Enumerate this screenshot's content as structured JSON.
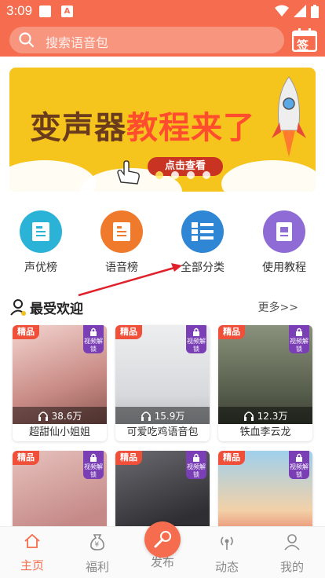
{
  "status_bar": {
    "time": "3:09"
  },
  "search": {
    "placeholder": "搜索语音包",
    "signin_label": "签"
  },
  "banner": {
    "headline_part1": "变声器",
    "headline_part2": "教程来了",
    "cta": "点击查看"
  },
  "categories": [
    {
      "label": "声优榜",
      "color": "#2bb3d7",
      "icon": "voice-actor-icon"
    },
    {
      "label": "语音榜",
      "color": "#f07a2b",
      "icon": "voice-rank-icon"
    },
    {
      "label": "全部分类",
      "color": "#2e86d4",
      "icon": "all-categories-icon"
    },
    {
      "label": "使用教程",
      "color": "#8f6bd6",
      "icon": "tutorial-icon"
    }
  ],
  "section": {
    "title": "最受欢迎",
    "more": "更多>>"
  },
  "cards": [
    {
      "badge": "精品",
      "lock": "视频解锁",
      "plays": "38.6万",
      "name": "超甜仙小姐姐",
      "img_color": "#e8b9b4"
    },
    {
      "badge": "精品",
      "lock": "视频解锁",
      "plays": "15.9万",
      "name": "可爱吃鸡语音包",
      "img_color": "#dfe0e3"
    },
    {
      "badge": "精品",
      "lock": "视频解锁",
      "plays": "12.3万",
      "name": "铁血李云龙",
      "img_color": "#6c7560"
    },
    {
      "badge": "精品",
      "lock": "视频解锁",
      "plays": "",
      "name": "",
      "img_color": "#d9a7a0"
    },
    {
      "badge": "精品",
      "lock": "视频解锁",
      "plays": "",
      "name": "",
      "img_color": "#3f3f44"
    },
    {
      "badge": "精品",
      "lock": "视频解锁",
      "plays": "",
      "name": "",
      "img_color": "#7fb7d6"
    }
  ],
  "tabs": [
    {
      "label": "主页",
      "icon": "home-icon",
      "active": true
    },
    {
      "label": "福利",
      "icon": "money-bag-icon",
      "active": false
    },
    {
      "label": "发布",
      "icon": "microphone-icon",
      "active": false
    },
    {
      "label": "动态",
      "icon": "broadcast-icon",
      "active": false
    },
    {
      "label": "我的",
      "icon": "user-icon",
      "active": false
    }
  ],
  "colors": {
    "primary": "#f56d4e",
    "annotation_arrow": "#e0202a"
  }
}
